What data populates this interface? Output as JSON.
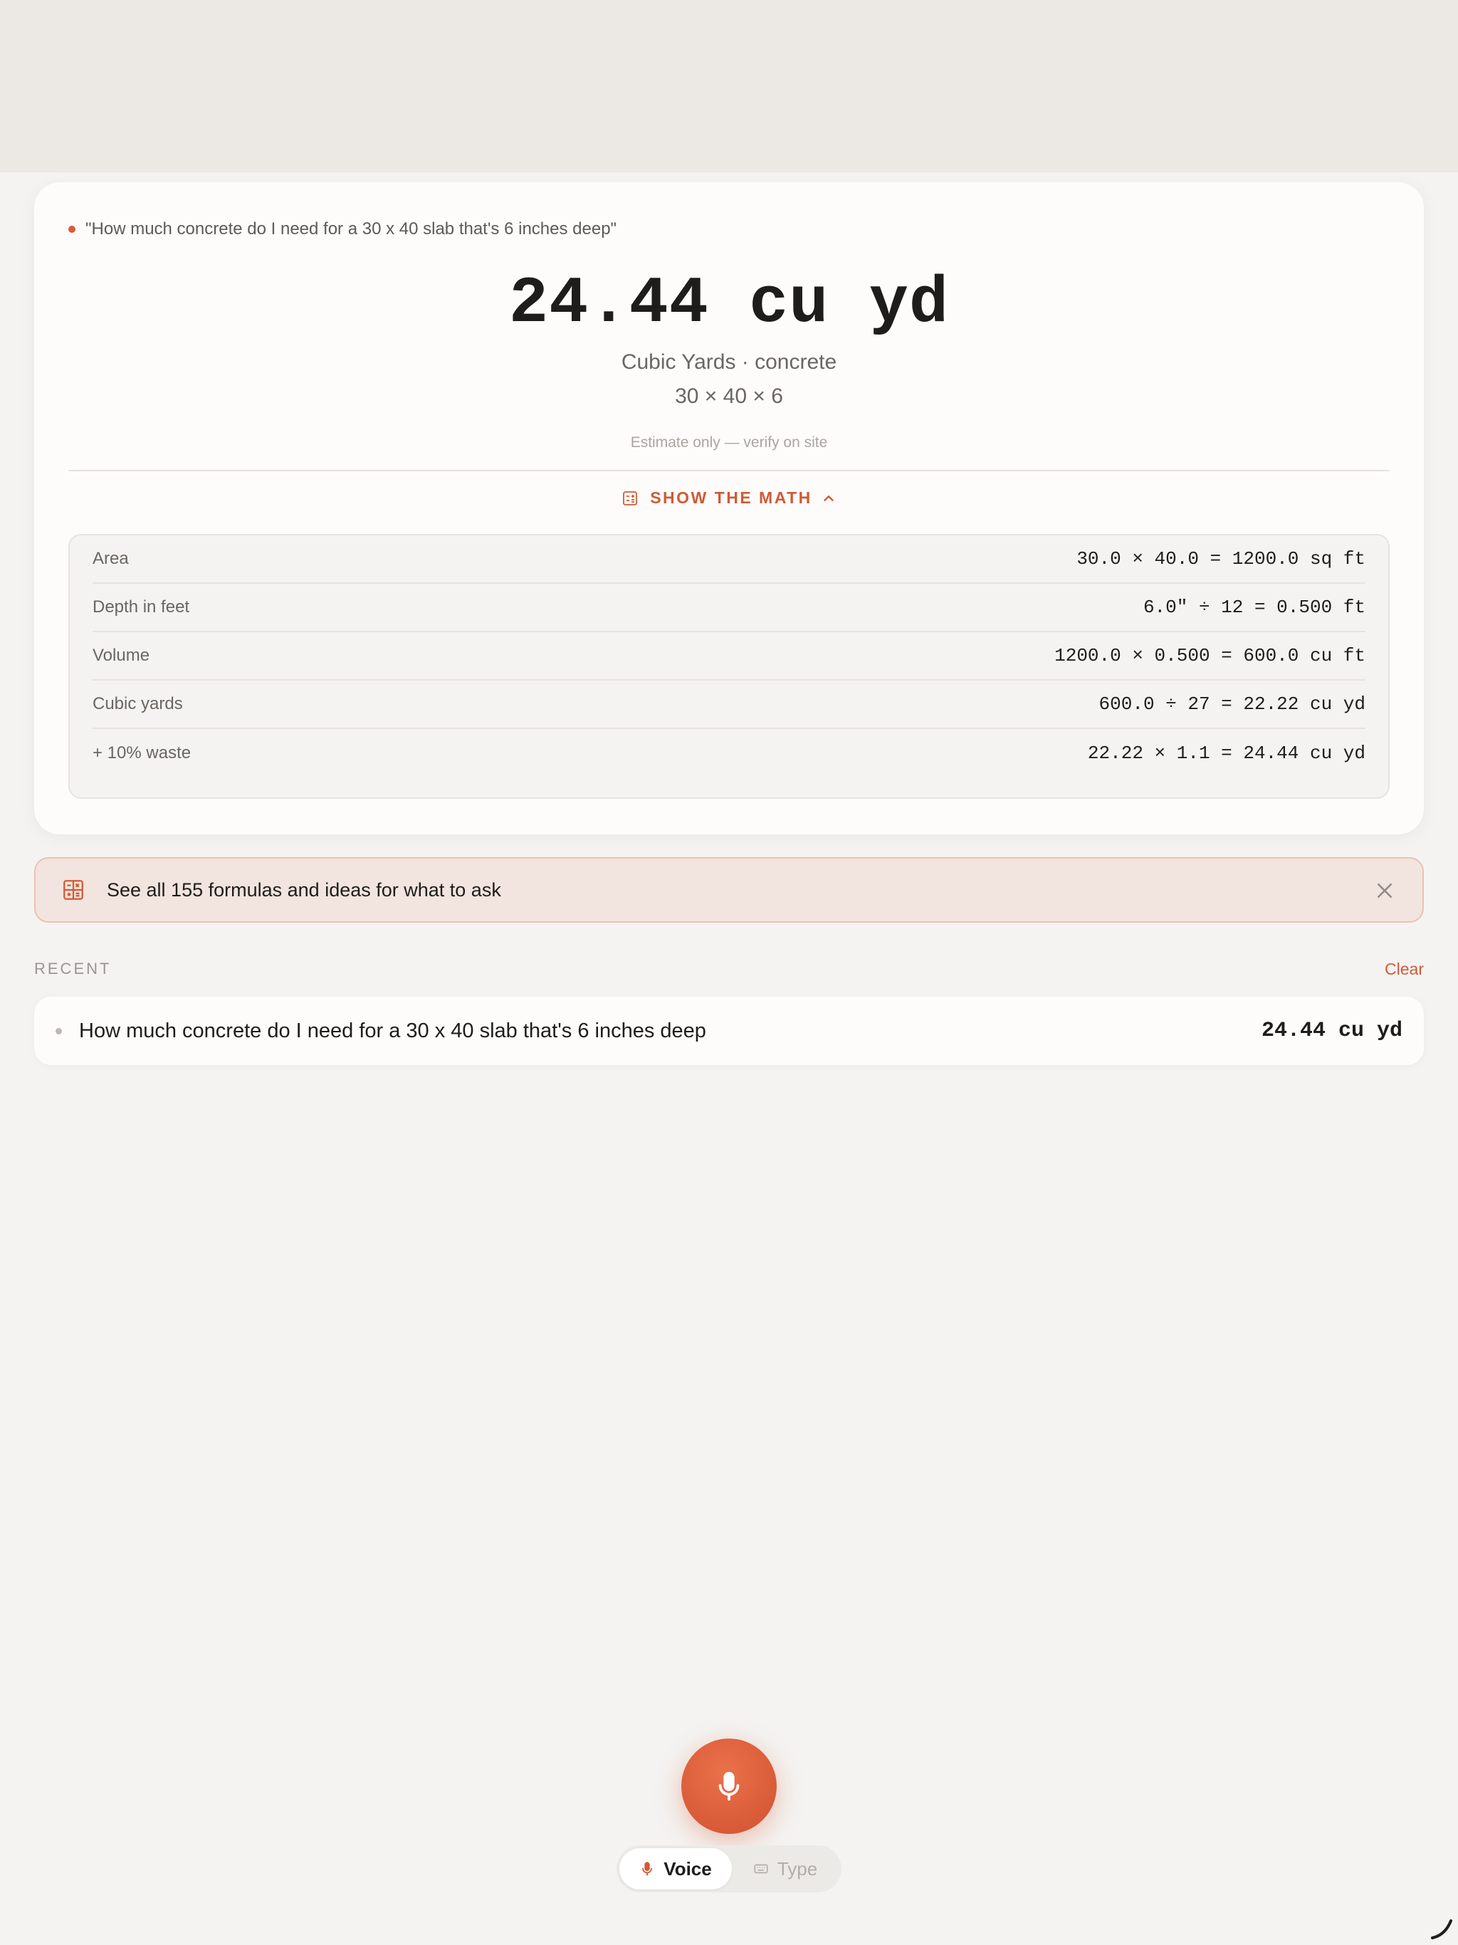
{
  "result_card": {
    "query": "\"How much concrete do I need for a 30 x 40 slab that's 6 inches deep\"",
    "answer": "24.44 cu yd",
    "unit_description": "Cubic Yards · concrete",
    "dimensions": "30 × 40 × 6",
    "disclaimer": "Estimate only — verify on site",
    "show_math_label": "SHOW THE MATH",
    "math_rows": [
      {
        "label": "Area",
        "value": "30.0 × 40.0 = 1200.0 sq ft"
      },
      {
        "label": "Depth in feet",
        "value": "6.0″ ÷ 12 = 0.500 ft"
      },
      {
        "label": "Volume",
        "value": "1200.0 × 0.500 = 600.0 cu ft"
      },
      {
        "label": "Cubic yards",
        "value": "600.0 ÷ 27 = 22.22 cu yd"
      },
      {
        "label": "+ 10% waste",
        "value": "22.22 × 1.1 = 24.44 cu yd"
      }
    ]
  },
  "banner": {
    "text": "See all 155 formulas and ideas for what to ask",
    "icon": "calculator-icon",
    "close_icon": "close-icon"
  },
  "recent": {
    "heading": "RECENT",
    "clear_label": "Clear",
    "items": [
      {
        "question": "How much concrete do I need for a 30 x 40 slab that's 6 inches deep",
        "answer": "24.44 cu yd"
      }
    ]
  },
  "input_modes": {
    "voice_label": "Voice",
    "type_label": "Type",
    "selected": "Voice"
  },
  "colors": {
    "accent": "#d05a36",
    "background": "#f4f3f1",
    "card": "#fdfcfb",
    "banner_bg": "#f2e4de"
  }
}
